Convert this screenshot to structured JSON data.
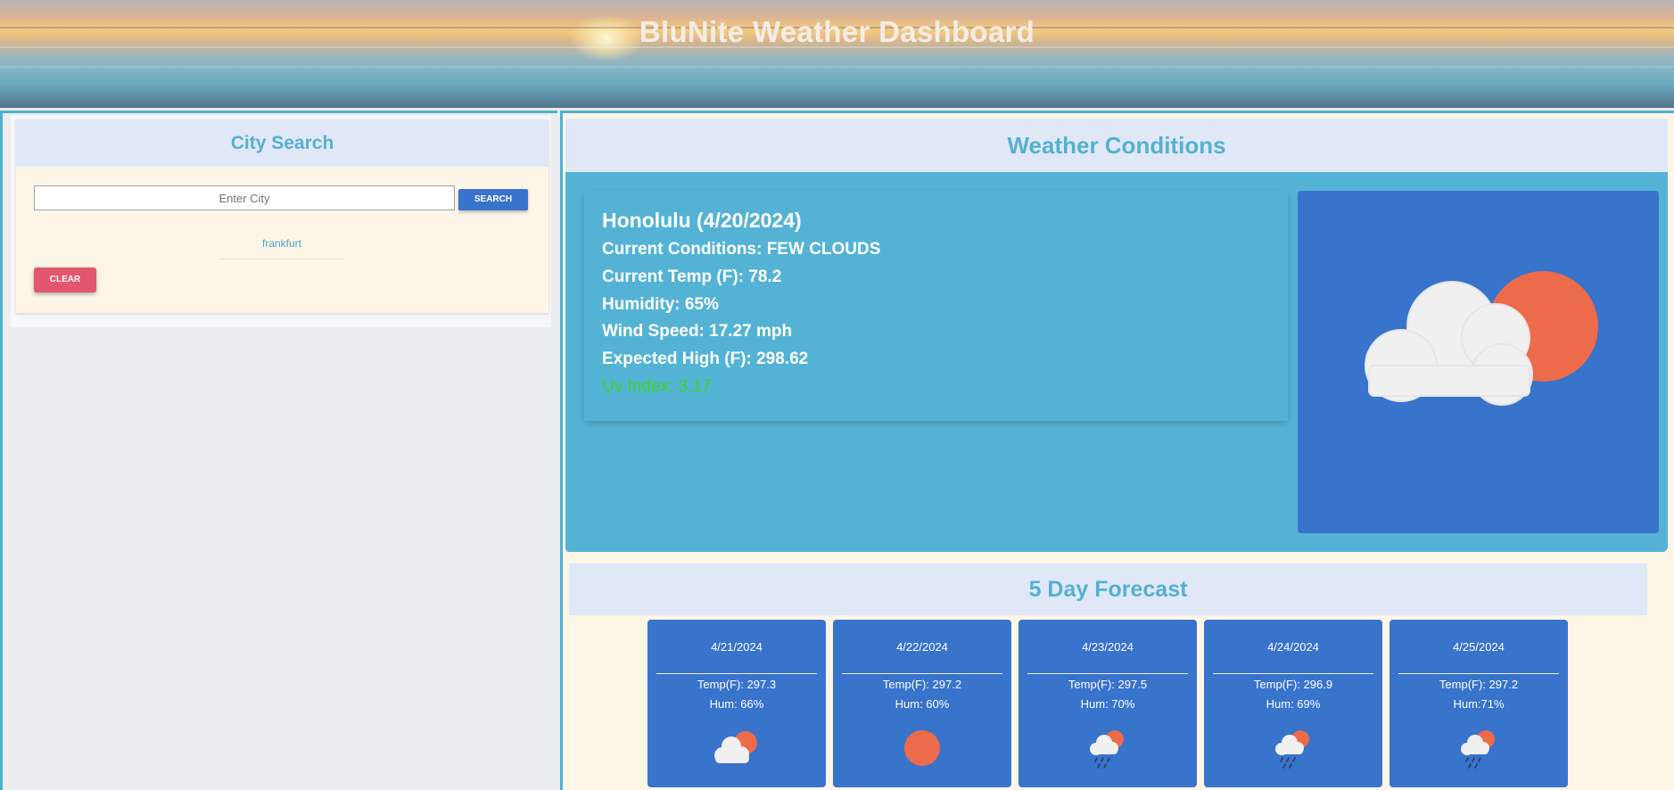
{
  "header": {
    "title": "BluNite Weather Dashboard"
  },
  "search": {
    "title": "City Search",
    "placeholder": "Enter City",
    "search_label": "SEARCH",
    "history": [
      "frankfurt"
    ],
    "clear_label": "CLEAR"
  },
  "current": {
    "section_title": "Weather Conditions",
    "city_date": "Honolulu (4/20/2024)",
    "conditions": "Current Conditions: FEW CLOUDS",
    "temp": "Current Temp (F): 78.2",
    "humidity": "Humidity: 65%",
    "wind": "Wind Speed: 17.27 mph",
    "high": "Expected High (F): 298.62",
    "uv": "Uv Index: 3.17",
    "icon": "few-clouds-day-icon"
  },
  "forecast": {
    "title": "5 Day Forecast",
    "days": [
      {
        "date": "4/21/2024",
        "temp": "Temp(F): 297.3",
        "hum": "Hum: 66%",
        "icon": "few-clouds-icon"
      },
      {
        "date": "4/22/2024",
        "temp": "Temp(F): 297.2",
        "hum": "Hum: 60%",
        "icon": "sun-icon"
      },
      {
        "date": "4/23/2024",
        "temp": "Temp(F): 297.5",
        "hum": "Hum: 70%",
        "icon": "rain-icon"
      },
      {
        "date": "4/24/2024",
        "temp": "Temp(F): 296.9",
        "hum": "Hum: 69%",
        "icon": "rain-icon"
      },
      {
        "date": "4/25/2024",
        "temp": "Temp(F): 297.2",
        "hum": "Hum:71%",
        "icon": "rain-icon"
      }
    ]
  },
  "colors": {
    "accent": "#55b0d0",
    "card_blue": "#3873cc",
    "panel_blue": "#54b3d5",
    "clear_red": "#e2566e",
    "uv_green": "#3cd51f",
    "sun_orange": "#ec6b4a"
  }
}
